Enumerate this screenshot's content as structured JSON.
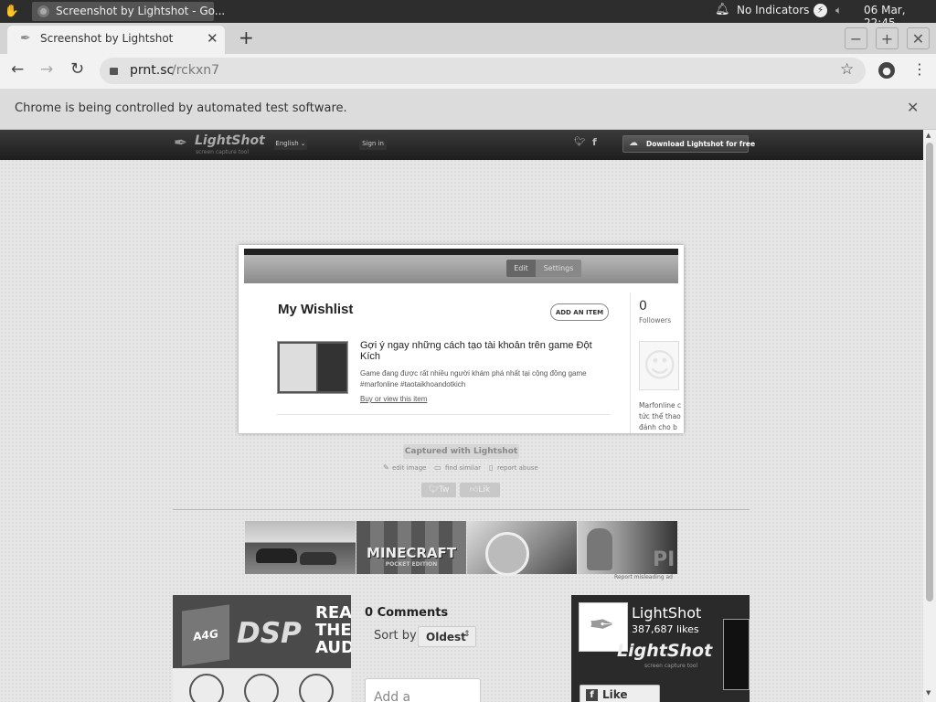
{
  "taskbar": {
    "app_title": "Screenshot by Lightshot - Go...",
    "notifications": "No Indicators",
    "datetime": "06 Mar, 22:45"
  },
  "tab": {
    "title": "Screenshot by Lightshot"
  },
  "address": {
    "host": "prnt.sc",
    "path": "/rckxn7"
  },
  "infobar": {
    "message": "Chrome is being controlled by automated test software."
  },
  "lightshot": {
    "logo": "LightShot",
    "logo_sub": "screen capture tool",
    "language": "English",
    "signin": "Sign in",
    "download": "Download Lightshot for free"
  },
  "card": {
    "edit": "Edit",
    "settings": "Settings",
    "title": "My Wishlist",
    "add_item": "ADD AN ITEM",
    "item_title": "Gợi ý ngay những cách tạo tài khoản trên game Đột Kích",
    "item_desc": "Game đang được rất nhiều người khám phá nhất tại cộng đồng game #marfonline #taotaikhoandotkich",
    "item_link": "Buy or view this item",
    "followers_count": "0",
    "followers_label": "Followers",
    "side_text_1": "Marfonline c",
    "side_text_2": "tức thể thao",
    "side_text_3": "đánh cho b"
  },
  "captured": {
    "caption": "Captured with Lightshot",
    "edit_image": "edit image",
    "find_similar": "find similar",
    "report_abuse": "report abuse",
    "tweet": "Tw",
    "like": "Lik"
  },
  "ads": {
    "report": "Report misleading ad",
    "minecraft": "MINECRAFT",
    "minecraft_sub": "POCKET EDITION",
    "pi": "PI"
  },
  "dsp": {
    "letters": "A4G",
    "dsp": "DSP",
    "rea": "REA",
    "the": "THE",
    "aud": "AUD"
  },
  "comments": {
    "count": "0 Comments",
    "sort_label": "Sort by",
    "sort_value": "Oldest",
    "add_placeholder": "Add a"
  },
  "fb": {
    "name": "LightShot",
    "likes": "387,687 likes",
    "brand": "LightShot",
    "brand_sub": "screen capture tool",
    "like_page": "Like Page"
  }
}
